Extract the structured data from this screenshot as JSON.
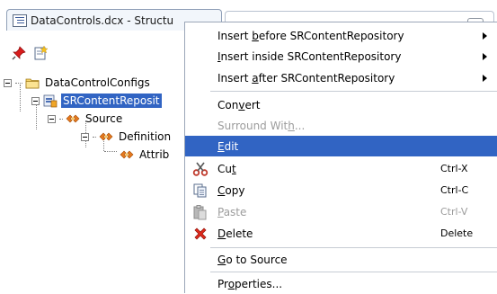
{
  "tab": {
    "title": "DataControls.dcx - Structu"
  },
  "tree": {
    "nodes": [
      {
        "label": "DataControlConfigs"
      },
      {
        "label": "SRContentReposit"
      },
      {
        "label": "Source"
      },
      {
        "label": "Definition"
      },
      {
        "label": "Attrib"
      }
    ]
  },
  "menu": {
    "insert_before": {
      "pre": "Insert ",
      "key": "b",
      "post": "efore SRContentRepository"
    },
    "insert_inside": {
      "pre": "",
      "key": "I",
      "post": "nsert inside SRContentRepository"
    },
    "insert_after": {
      "pre": "Insert ",
      "key": "a",
      "post": "fter SRContentRepository"
    },
    "convert": {
      "pre": "Con",
      "key": "v",
      "post": "ert"
    },
    "surround": {
      "pre": "Surround Wit",
      "key": "h",
      "post": "..."
    },
    "edit": {
      "pre": "",
      "key": "E",
      "post": "dit"
    },
    "cut": {
      "pre": "Cu",
      "key": "t",
      "post": "",
      "shortcut": "Ctrl-X"
    },
    "copy": {
      "pre": "",
      "key": "C",
      "post": "opy",
      "shortcut": "Ctrl-C"
    },
    "paste": {
      "pre": "",
      "key": "P",
      "post": "aste",
      "shortcut": "Ctrl-V"
    },
    "delete": {
      "pre": "",
      "key": "D",
      "post": "elete",
      "shortcut": "Delete"
    },
    "goto_source": {
      "pre": "",
      "key": "G",
      "post": "o to Source"
    },
    "properties": {
      "pre": "Pr",
      "key": "o",
      "post": "perties..."
    }
  },
  "colors": {
    "selection": "#3164c3",
    "disabled_text": "#9c9c9c"
  }
}
